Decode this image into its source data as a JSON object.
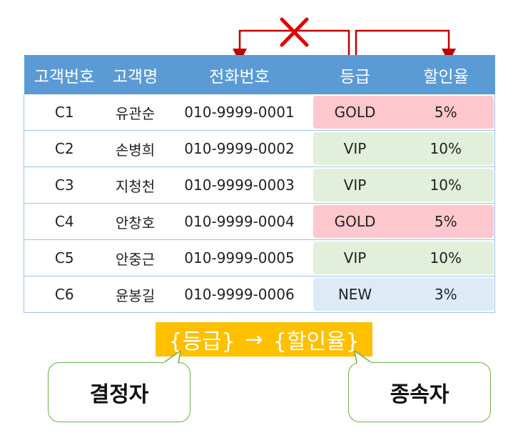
{
  "table": {
    "headers": [
      "고객번호",
      "고객명",
      "전화번호",
      "등급",
      "할인율"
    ],
    "rows": [
      {
        "id": "C1",
        "name": "유관순",
        "phone": "010-9999-0001",
        "grade": "GOLD",
        "rate": "5%",
        "color": "#ffc7ce"
      },
      {
        "id": "C2",
        "name": "손병희",
        "phone": "010-9999-0002",
        "grade": "VIP",
        "rate": "10%",
        "color": "#e2efda"
      },
      {
        "id": "C3",
        "name": "지청천",
        "phone": "010-9999-0003",
        "grade": "VIP",
        "rate": "10%",
        "color": "#e2efda"
      },
      {
        "id": "C4",
        "name": "안창호",
        "phone": "010-9999-0004",
        "grade": "GOLD",
        "rate": "5%",
        "color": "#ffc7ce"
      },
      {
        "id": "C5",
        "name": "안중근",
        "phone": "010-9999-0005",
        "grade": "VIP",
        "rate": "10%",
        "color": "#e2efda"
      },
      {
        "id": "C6",
        "name": "윤봉길",
        "phone": "010-9999-0006",
        "grade": "NEW",
        "rate": "3%",
        "color": "#ddebf7"
      }
    ]
  },
  "dependency": {
    "determinant": "{등급}",
    "arrow": "→",
    "dependent": "{할인율}"
  },
  "callouts": {
    "left": "결정자",
    "right": "종속자"
  },
  "colors": {
    "header": "#5b9bd5",
    "arrow": "#c00000",
    "box": "#ffc000",
    "callout_border": "#70ad47",
    "gold": "#ffc7ce",
    "vip": "#e2efda",
    "new": "#ddebf7"
  }
}
